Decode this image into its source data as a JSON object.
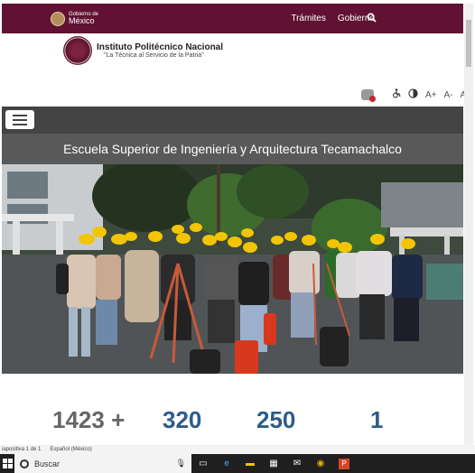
{
  "gov_header": {
    "logo_small": "Gobierno de",
    "logo_big": "México",
    "nav": [
      "Trámites",
      "Gobierno"
    ]
  },
  "institution": {
    "name": "Instituto Politécnico Nacional",
    "motto": "\"La Técnica al Servicio de la Patria\""
  },
  "accessibility_tools": [
    "A+",
    "A-",
    "A"
  ],
  "school_title": "Escuela Superior de Ingeniería y Arquitectura Tecamachalco",
  "stats": [
    "1423 +",
    "320",
    "250",
    "1"
  ],
  "status_bar": {
    "slide": "iapositiva 1 de 1",
    "language": "Español (México)"
  },
  "taskbar": {
    "search_label": "Buscar"
  },
  "colors": {
    "gov_bar": "#611232",
    "menu_bar": "#444444",
    "school_bar": "#595959",
    "stat_blue": "#2c5c8a",
    "stat_gray": "#666666",
    "helmet": "#f2c500"
  }
}
